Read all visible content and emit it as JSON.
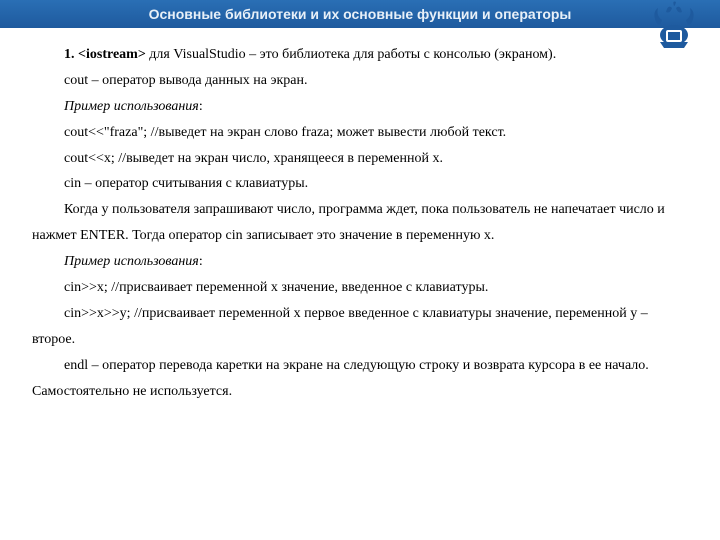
{
  "header": {
    "title": "Основные библиотеки и их основные функции и операторы"
  },
  "body": {
    "p1_num": "1. ",
    "p1_lib": "<iostream>",
    "p1_rest": " для VisualStudio – это библиотека для работы с консолью (экраном).",
    "p2": "cout – оператор вывода данных на экран.",
    "p3": "Пример использования",
    "p3_colon": ":",
    "p4": "cout<<\"fraza\"; //выведет на экран слово fraza; может вывести любой текст.",
    "p5": "cout<<x; //выведет на экран число, хранящееся в переменной x.",
    "p6": "cin – оператор считывания с клавиатуры.",
    "p7": "Когда у пользователя запрашивают число, программа ждет, пока пользователь не напечатает число и нажмет ENTER. Тогда оператор cin записывает это значение в переменную x.",
    "p8": "Пример использования",
    "p8_colon": ":",
    "p9": "cin>>x; //присваивает переменной x значение, введенное с клавиатуры.",
    "p10": "cin>>x>>y; //присваивает переменной x первое введенное c клавиатуры значение, переменной y – второе.",
    "p11": "endl – оператор перевода каретки на экране на следующую строку и возврата курсора в ее начало. Самостоятельно не используется."
  }
}
